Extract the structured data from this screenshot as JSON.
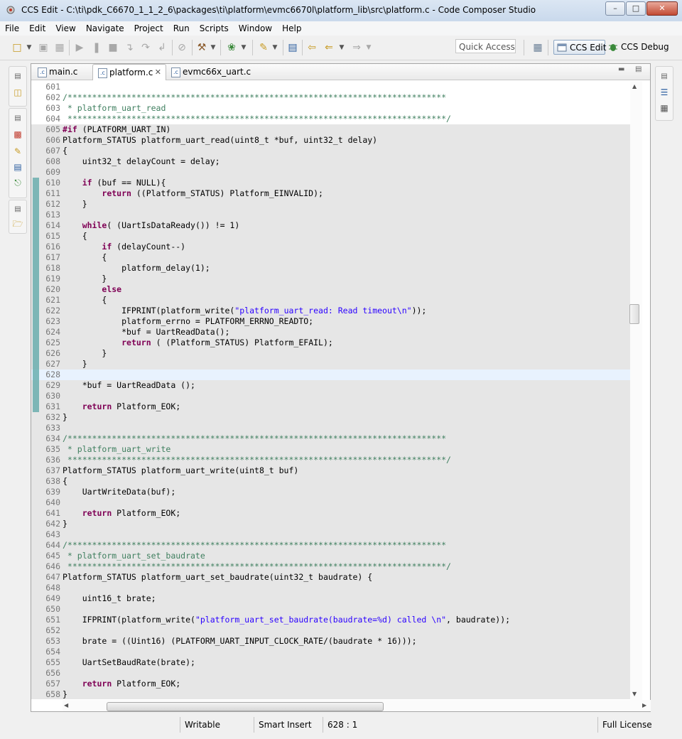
{
  "window": {
    "title": "CCS Edit - C:\\ti\\pdk_C6670_1_1_2_6\\packages\\ti\\platform\\evmc6670l\\platform_lib\\src\\platform.c - Code Composer Studio",
    "minimize": "–",
    "maximize": "□",
    "close": "✕"
  },
  "menu": [
    "File",
    "Edit",
    "View",
    "Navigate",
    "Project",
    "Run",
    "Scripts",
    "Window",
    "Help"
  ],
  "toolbar": {
    "quick_access_placeholder": "Quick Access",
    "perspectives": [
      {
        "label": "CCS Edit",
        "active": true
      },
      {
        "label": "CCS Debug",
        "active": false
      }
    ]
  },
  "tabs": [
    {
      "label": "main.c",
      "active": false
    },
    {
      "label": "platform.c",
      "active": true,
      "close": "✕"
    },
    {
      "label": "evmc66x_uart.c",
      "active": false
    }
  ],
  "editor": {
    "cursor_line": 628,
    "lines": [
      {
        "n": "601",
        "s": "n",
        "t": []
      },
      {
        "n": "602",
        "s": "n",
        "t": [
          [
            "c",
            "/*****************************************************************************"
          ]
        ]
      },
      {
        "n": "603",
        "s": "n",
        "t": [
          [
            "c",
            " * platform_uart_read"
          ]
        ]
      },
      {
        "n": "604",
        "s": "n",
        "t": [
          [
            "c",
            " *****************************************************************************/"
          ]
        ]
      },
      {
        "n": "605",
        "s": "s",
        "t": [
          [
            "k",
            "#if"
          ],
          [
            "p",
            " (PLATFORM_UART_IN)"
          ]
        ]
      },
      {
        "n": "606",
        "s": "s",
        "t": [
          [
            "p",
            "Platform_STATUS platform_uart_read(uint8_t *buf, uint32_t delay)"
          ]
        ]
      },
      {
        "n": "607",
        "s": "s",
        "t": [
          [
            "p",
            "{"
          ]
        ]
      },
      {
        "n": "608",
        "s": "s",
        "t": [
          [
            "p",
            "    uint32_t delayCount = delay;"
          ]
        ]
      },
      {
        "n": "609",
        "s": "s",
        "t": []
      },
      {
        "n": "610",
        "s": "s",
        "t": [
          [
            "p",
            "    "
          ],
          [
            "k",
            "if"
          ],
          [
            "p",
            " (buf == NULL){"
          ]
        ]
      },
      {
        "n": "611",
        "s": "s",
        "t": [
          [
            "p",
            "        "
          ],
          [
            "k",
            "return"
          ],
          [
            "p",
            " ((Platform_STATUS) Platform_EINVALID);"
          ]
        ]
      },
      {
        "n": "612",
        "s": "s",
        "t": [
          [
            "p",
            "    }"
          ]
        ]
      },
      {
        "n": "613",
        "s": "s",
        "t": []
      },
      {
        "n": "614",
        "s": "s",
        "t": [
          [
            "p",
            "    "
          ],
          [
            "k",
            "while"
          ],
          [
            "p",
            "( (UartIsDataReady()) != 1)"
          ]
        ]
      },
      {
        "n": "615",
        "s": "s",
        "t": [
          [
            "p",
            "    {"
          ]
        ]
      },
      {
        "n": "616",
        "s": "s",
        "t": [
          [
            "p",
            "        "
          ],
          [
            "k",
            "if"
          ],
          [
            "p",
            " (delayCount--)"
          ]
        ]
      },
      {
        "n": "617",
        "s": "s",
        "t": [
          [
            "p",
            "        {"
          ]
        ]
      },
      {
        "n": "618",
        "s": "s",
        "t": [
          [
            "p",
            "            platform_delay(1);"
          ]
        ]
      },
      {
        "n": "619",
        "s": "s",
        "t": [
          [
            "p",
            "        }"
          ]
        ]
      },
      {
        "n": "620",
        "s": "s",
        "t": [
          [
            "p",
            "        "
          ],
          [
            "k",
            "else"
          ]
        ]
      },
      {
        "n": "621",
        "s": "s",
        "t": [
          [
            "p",
            "        {"
          ]
        ]
      },
      {
        "n": "622",
        "s": "s",
        "t": [
          [
            "p",
            "            IFPRINT(platform_write("
          ],
          [
            "q",
            "\"platform_uart_read: Read timeout\\n\""
          ],
          [
            "p",
            "));"
          ]
        ]
      },
      {
        "n": "623",
        "s": "s",
        "t": [
          [
            "p",
            "            platform_errno = PLATFORM_ERRNO_READTO;"
          ]
        ]
      },
      {
        "n": "624",
        "s": "s",
        "t": [
          [
            "p",
            "            *buf = UartReadData();"
          ]
        ]
      },
      {
        "n": "625",
        "s": "s",
        "t": [
          [
            "p",
            "            "
          ],
          [
            "k",
            "return"
          ],
          [
            "p",
            " ( (Platform_STATUS) Platform_EFAIL);"
          ]
        ]
      },
      {
        "n": "626",
        "s": "s",
        "t": [
          [
            "p",
            "        }"
          ]
        ]
      },
      {
        "n": "627",
        "s": "s",
        "t": [
          [
            "p",
            "    }"
          ]
        ]
      },
      {
        "n": "628",
        "s": "c",
        "t": []
      },
      {
        "n": "629",
        "s": "s",
        "t": [
          [
            "p",
            "    *buf = UartReadData ();"
          ]
        ]
      },
      {
        "n": "630",
        "s": "s",
        "t": []
      },
      {
        "n": "631",
        "s": "s",
        "t": [
          [
            "p",
            "    "
          ],
          [
            "k",
            "return"
          ],
          [
            "p",
            " Platform_EOK;"
          ]
        ]
      },
      {
        "n": "632",
        "s": "s",
        "t": [
          [
            "p",
            "}"
          ]
        ]
      },
      {
        "n": "633",
        "s": "s",
        "t": []
      },
      {
        "n": "634",
        "s": "s",
        "t": [
          [
            "c",
            "/*****************************************************************************"
          ]
        ]
      },
      {
        "n": "635",
        "s": "s",
        "t": [
          [
            "c",
            " * platform_uart_write"
          ]
        ]
      },
      {
        "n": "636",
        "s": "s",
        "t": [
          [
            "c",
            " *****************************************************************************/"
          ]
        ]
      },
      {
        "n": "637",
        "s": "s",
        "t": [
          [
            "p",
            "Platform_STATUS platform_uart_write(uint8_t buf)"
          ]
        ]
      },
      {
        "n": "638",
        "s": "s",
        "t": [
          [
            "p",
            "{"
          ]
        ]
      },
      {
        "n": "639",
        "s": "s",
        "t": [
          [
            "p",
            "    UartWriteData(buf);"
          ]
        ]
      },
      {
        "n": "640",
        "s": "s",
        "t": []
      },
      {
        "n": "641",
        "s": "s",
        "t": [
          [
            "p",
            "    "
          ],
          [
            "k",
            "return"
          ],
          [
            "p",
            " Platform_EOK;"
          ]
        ]
      },
      {
        "n": "642",
        "s": "s",
        "t": [
          [
            "p",
            "}"
          ]
        ]
      },
      {
        "n": "643",
        "s": "s",
        "t": []
      },
      {
        "n": "644",
        "s": "s",
        "t": [
          [
            "c",
            "/*****************************************************************************"
          ]
        ]
      },
      {
        "n": "645",
        "s": "s",
        "t": [
          [
            "c",
            " * platform_uart_set_baudrate"
          ]
        ]
      },
      {
        "n": "646",
        "s": "s",
        "t": [
          [
            "c",
            " *****************************************************************************/"
          ]
        ]
      },
      {
        "n": "647",
        "s": "s",
        "t": [
          [
            "p",
            "Platform_STATUS platform_uart_set_baudrate(uint32_t baudrate) {"
          ]
        ]
      },
      {
        "n": "648",
        "s": "s",
        "t": []
      },
      {
        "n": "649",
        "s": "s",
        "t": [
          [
            "p",
            "    uint16_t brate;"
          ]
        ]
      },
      {
        "n": "650",
        "s": "s",
        "t": []
      },
      {
        "n": "651",
        "s": "s",
        "t": [
          [
            "p",
            "    IFPRINT(platform_write("
          ],
          [
            "q",
            "\"platform_uart_set_baudrate(baudrate=%d) called \\n\""
          ],
          [
            "p",
            ", baudrate));"
          ]
        ]
      },
      {
        "n": "652",
        "s": "s",
        "t": []
      },
      {
        "n": "653",
        "s": "s",
        "t": [
          [
            "p",
            "    brate = ((Uint16) (PLATFORM_UART_INPUT_CLOCK_RATE/(baudrate * 16)));"
          ]
        ]
      },
      {
        "n": "654",
        "s": "s",
        "t": []
      },
      {
        "n": "655",
        "s": "s",
        "t": [
          [
            "p",
            "    UartSetBaudRate(brate);"
          ]
        ]
      },
      {
        "n": "656",
        "s": "s",
        "t": []
      },
      {
        "n": "657",
        "s": "s",
        "t": [
          [
            "p",
            "    "
          ],
          [
            "k",
            "return"
          ],
          [
            "p",
            " Platform_EOK;"
          ]
        ]
      },
      {
        "n": "658",
        "s": "s",
        "t": [
          [
            "p",
            "}"
          ]
        ]
      }
    ]
  },
  "status": {
    "writable": "Writable",
    "insert_mode": "Smart Insert",
    "position": "628 : 1",
    "license": "Full License"
  },
  "colors": {
    "keyword": "#7f0055",
    "comment": "#3f7f5f",
    "string": "#2a00ff",
    "inactive_bg": "#e6e6e6",
    "current_line": "#e8f2fe",
    "change_bar": "#5aa5a5"
  }
}
